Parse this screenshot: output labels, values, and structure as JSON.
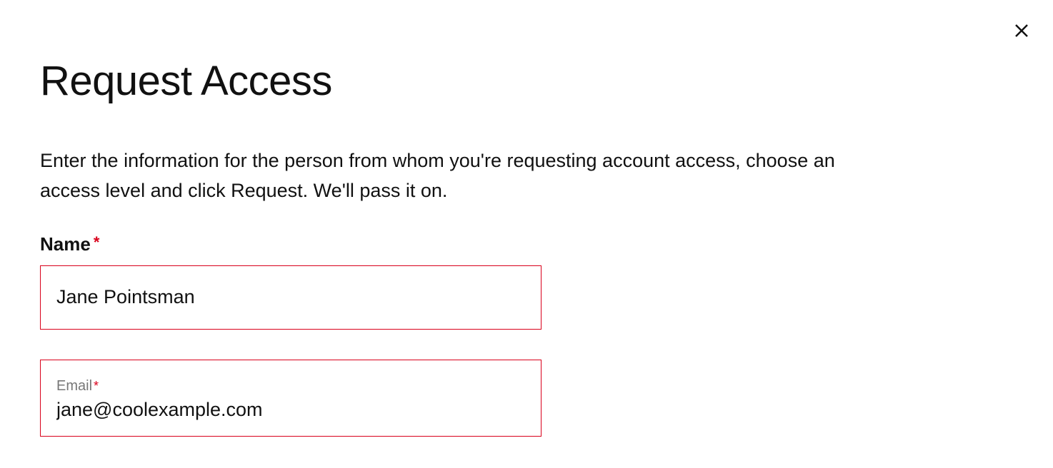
{
  "dialog": {
    "title": "Request Access",
    "description": "Enter the information for the person from whom you're requesting account access, choose an access level and click Request. We'll pass it on.",
    "required_mark": "*"
  },
  "form": {
    "name": {
      "label": "Name",
      "value": "Jane Pointsman"
    },
    "email": {
      "label": "Email",
      "value": "jane@coolexample.com"
    }
  }
}
